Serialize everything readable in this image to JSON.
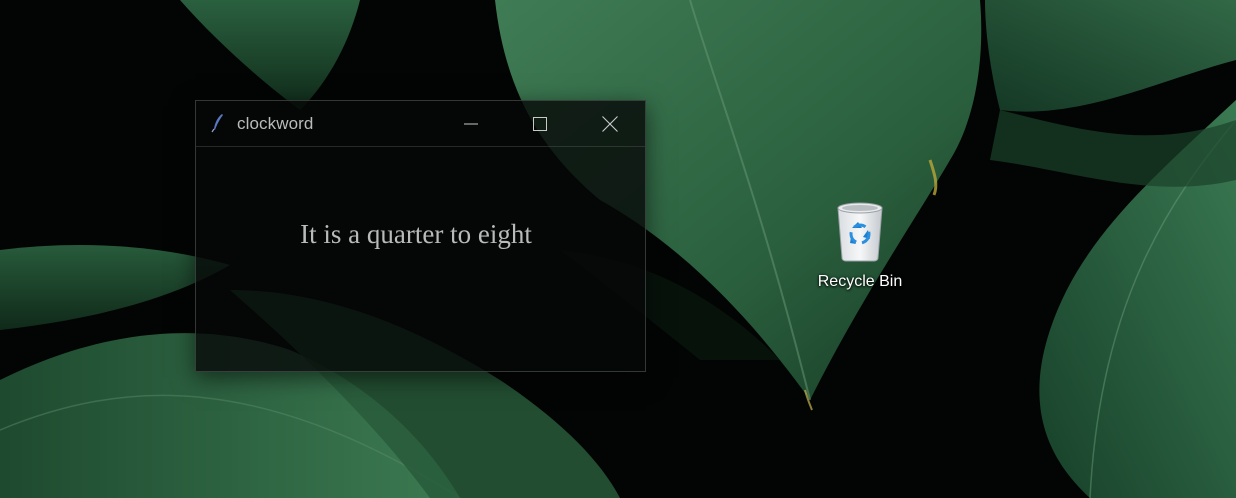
{
  "window": {
    "title": "clockword",
    "clock_text": "It is a quarter to eight",
    "buttons": {
      "minimize_icon": "minimize-icon",
      "maximize_icon": "maximize-icon",
      "close_icon": "close-icon"
    }
  },
  "desktop": {
    "icons": [
      {
        "label": "Recycle Bin",
        "icon": "recycle-bin-icon"
      }
    ]
  },
  "colors": {
    "leaf_green": "#2f6a45",
    "leaf_dark": "#14331f",
    "background": "#030504",
    "window_text": "#b9bbba"
  }
}
